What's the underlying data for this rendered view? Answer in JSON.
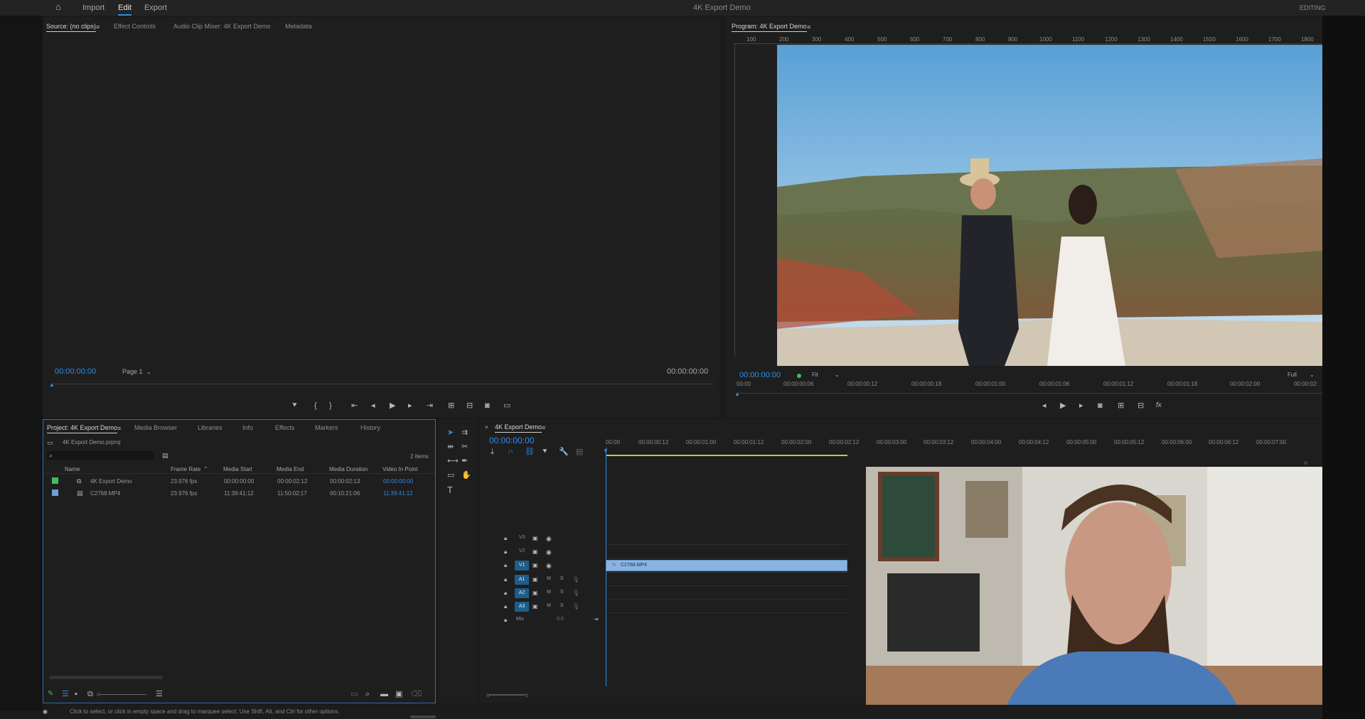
{
  "app": {
    "title": "4K Export Demo",
    "workspace": "EDITING",
    "nav": [
      "Import",
      "Edit",
      "Export"
    ],
    "active_nav": "Edit"
  },
  "source_panel": {
    "tabs": [
      "Source: (no clips)",
      "Effect Controls",
      "Audio Clip Mixer: 4K Export Demo",
      "Metadata"
    ],
    "timecode_left": "00:00:00:00",
    "page_label": "Page 1",
    "timecode_right": "00:00:00:00"
  },
  "program_panel": {
    "tab": "Program: 4K Export Demo",
    "ruler_ticks": [
      "100",
      "200",
      "300",
      "400",
      "500",
      "600",
      "700",
      "800",
      "900",
      "1000",
      "1100",
      "1200",
      "1300",
      "1400",
      "1500",
      "1600",
      "1700",
      "1800"
    ],
    "timecode": "00:00:00:00",
    "fit_label": "Fit",
    "quality_label": "Full",
    "timeline_ticks": [
      "00:00",
      "00:00:00:06",
      "00:00:00:12",
      "00:00:00:18",
      "00:00:01:00",
      "00:00:01:06",
      "00:00:01:12",
      "00:00:01:18",
      "00:00:02:00",
      "00:00:02:"
    ]
  },
  "project_panel": {
    "tabs": [
      "Project: 4K Export Demo",
      "Media Browser",
      "Libraries",
      "Info",
      "Effects",
      "Markers",
      "History"
    ],
    "file": "4K Export Demo.prproj",
    "item_count": "2 items",
    "columns": [
      "Name",
      "Frame Rate",
      "Media Start",
      "Media End",
      "Media Duration",
      "Video In Point"
    ],
    "rows": [
      {
        "color": "#3fbf5a",
        "name": "4K Export Demo",
        "fps": "23.976 fps",
        "start": "00:00:00:00",
        "end": "00:00:02:12",
        "duration": "00:00:02:13",
        "in": "00:00:00:00"
      },
      {
        "color": "#6f9fd8",
        "name": "C2768.MP4",
        "fps": "23.976 fps",
        "start": "11:39:41:12",
        "end": "11:50:02:17",
        "duration": "00:10:21:06",
        "in": "11:39:41:12"
      }
    ]
  },
  "timeline_panel": {
    "tab": "4K Export Demo",
    "timecode": "00:00:00:00",
    "ruler_ticks": [
      "00:00",
      "00:00:00:12",
      "00:00:01:00",
      "00:00:01:12",
      "00:00:02:00",
      "00:00:02:12",
      "00:00:03:00",
      "00:00:03:12",
      "00:00:04:00",
      "00:00:04:12",
      "00:00:05:00",
      "00:00:05:12",
      "00:00:06:00",
      "00:00:06:12",
      "00:00:07:00"
    ],
    "video_tracks": [
      "V3",
      "V2",
      "V1"
    ],
    "audio_tracks": [
      "A1",
      "A2",
      "A3"
    ],
    "mix_label": "Mix",
    "mix_value": "0.0",
    "clip_name": "C2768.MP4",
    "m_label": "M",
    "s_label": "S"
  },
  "status_bar": {
    "text": "Click to select, or click in empty space and drag to marquee select. Use Shift, Alt, and Ctrl for other options."
  },
  "colors": {
    "accent": "#2d8ceb",
    "clip": "#8ab4e0",
    "track_target": "#1f5e8a"
  }
}
